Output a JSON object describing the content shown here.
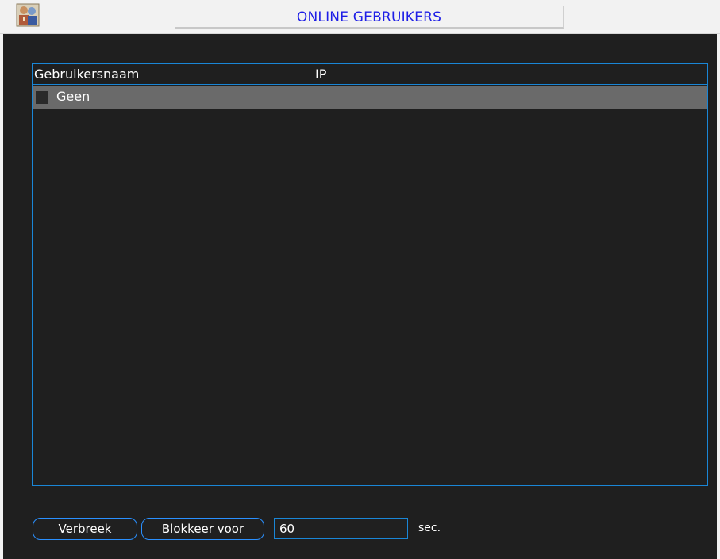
{
  "window": {
    "title": "ONLINE GEBRUIKERS",
    "icon": "users-icon"
  },
  "table": {
    "columns": [
      "Gebruikersnaam",
      "IP"
    ],
    "rows": [
      {
        "username": "Geen",
        "ip": "",
        "checked": false,
        "selected": true
      }
    ]
  },
  "actions": {
    "disconnect_label": "Verbreek",
    "block_label": "Blokkeer voor",
    "block_seconds_value": "60",
    "unit_label": "sec."
  },
  "colors": {
    "accent_border": "#1a86d6",
    "title_text": "#1e1ee6",
    "selected_row": "#6a6a6a",
    "background": "#1f1f1f"
  }
}
